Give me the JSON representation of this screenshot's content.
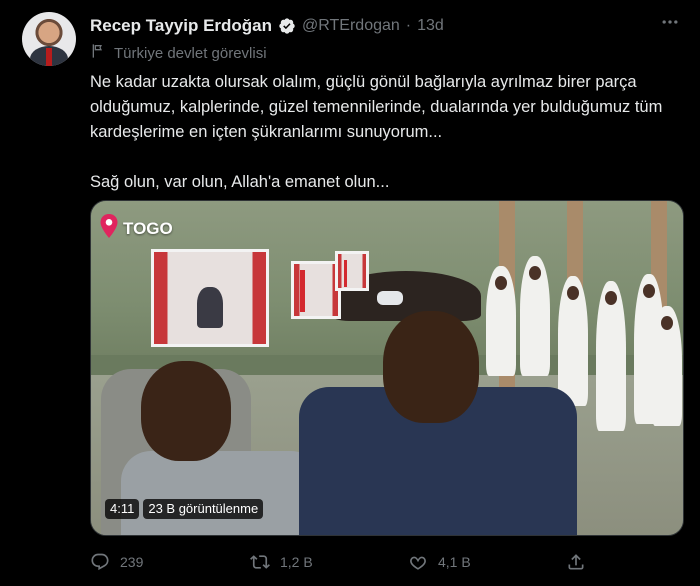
{
  "tweet": {
    "author": {
      "name": "Recep Tayyip Erdoğan",
      "handle": "@RTErdogan",
      "separator": "·",
      "time": "13d",
      "verified": true
    },
    "label": {
      "icon": "flag-icon",
      "text": "Türkiye devlet görevlisi"
    },
    "more_icon": "more-icon",
    "text": {
      "paragraph1": "Ne kadar uzakta olursak olalım, güçlü gönül bağlarıyla ayrılmaz birer parça olduğumuz, kalplerinde, güzel temennilerinde, dualarında yer bulduğumuz tüm kardeşlerime en içten şükranlarımı sunuyorum...",
      "paragraph2": "Sağ olun, var olun, Allah'a emanet olun..."
    },
    "media": {
      "location_icon": "map-pin-icon",
      "location_label": "TOGO",
      "duration": "4:11",
      "views": "23 B görüntülenme"
    },
    "actions": {
      "reply": {
        "icon": "reply-icon",
        "count": "239"
      },
      "retweet": {
        "icon": "retweet-icon",
        "count": "1,2 B"
      },
      "like": {
        "icon": "heart-icon",
        "count": "4,1 B"
      },
      "share": {
        "icon": "share-icon"
      }
    }
  },
  "colors": {
    "background": "#000000",
    "text_primary": "#e7e9ea",
    "text_secondary": "#71767b",
    "verified": "#1d9bf0",
    "pin": "#e0245e"
  }
}
